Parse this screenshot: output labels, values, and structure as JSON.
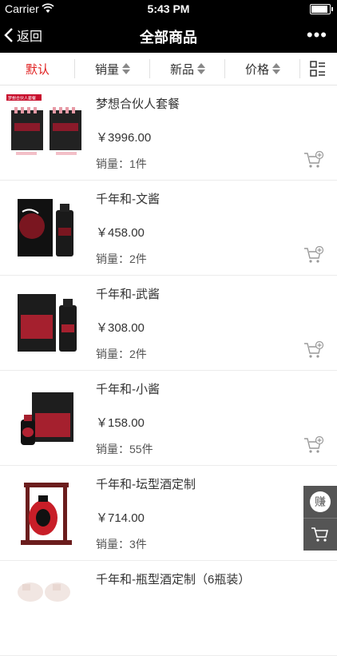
{
  "status_bar": {
    "carrier": "Carrier",
    "time": "5:43 PM"
  },
  "nav": {
    "back_label": "返回",
    "title": "全部商品",
    "more_label": "•••"
  },
  "sort_tabs": [
    "默认",
    "销量",
    "新品",
    "价格"
  ],
  "products": [
    {
      "name": "梦想合伙人套餐",
      "price": "￥3996.00",
      "sales": "销量：1件",
      "badge": "梦想合伙人套餐"
    },
    {
      "name": "千年和-文酱",
      "price": "￥458.00",
      "sales": "销量：2件"
    },
    {
      "name": "千年和-武酱",
      "price": "￥308.00",
      "sales": "销量：2件"
    },
    {
      "name": "千年和-小酱",
      "price": "￥158.00",
      "sales": "销量：55件"
    },
    {
      "name": "千年和-坛型酒定制",
      "price": "￥714.00",
      "sales": "销量：3件"
    },
    {
      "name": "千年和-瓶型酒定制（6瓶装）",
      "price": "",
      "sales": ""
    }
  ],
  "float": {
    "earn_label": "赚"
  },
  "colors": {
    "active_tab": "#e02020",
    "bar_bg": "#000000"
  }
}
